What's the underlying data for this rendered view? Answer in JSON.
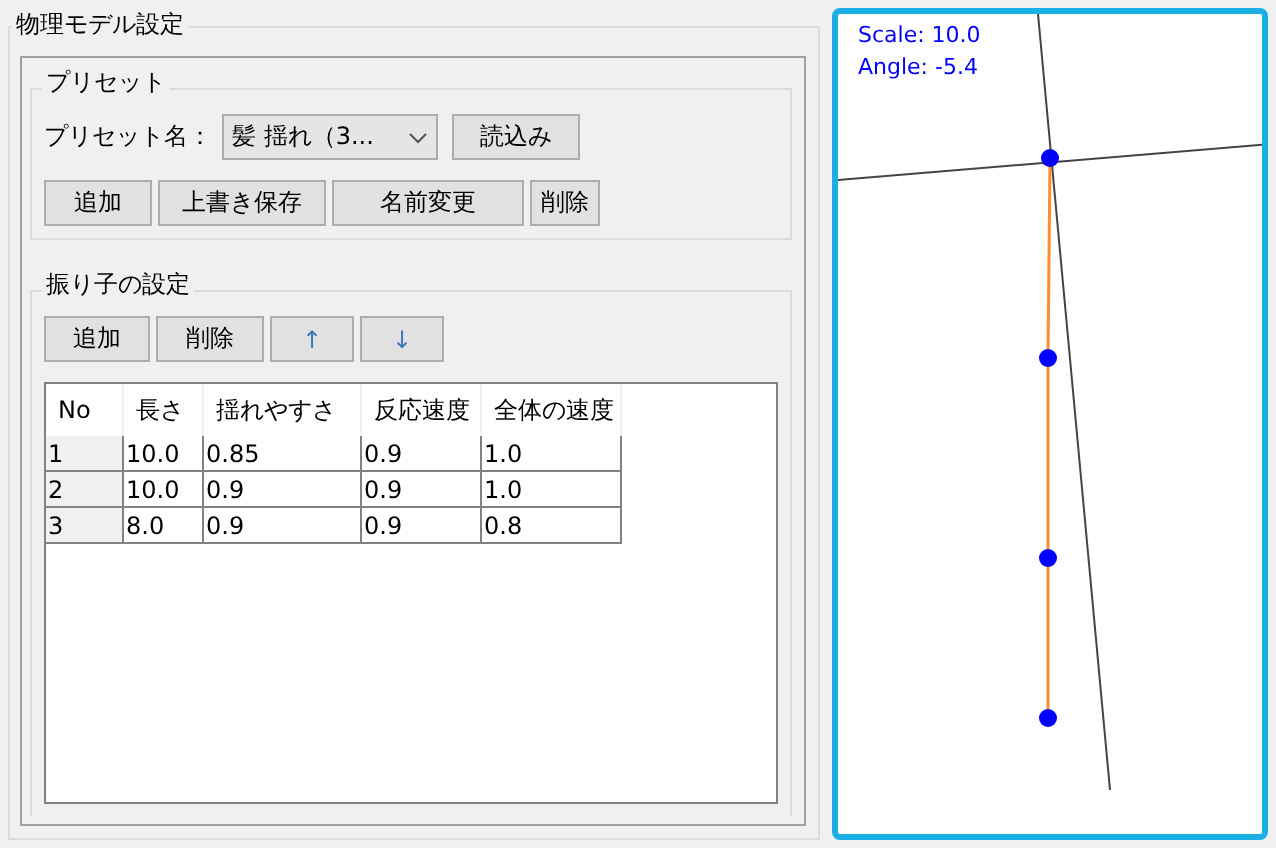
{
  "section_title": "物理モデル設定",
  "preset": {
    "title": "プリセット",
    "name_label": "プリセット名：",
    "selected_value": "髪  揺れ（3...",
    "load_button": "読込み",
    "buttons": [
      "追加",
      "上書き保存",
      "名前変更",
      "削除"
    ]
  },
  "pendulum": {
    "title": "振り子の設定",
    "buttons": [
      "追加",
      "削除",
      "↑",
      "↓"
    ],
    "table": {
      "columns": [
        "No",
        "長さ",
        "揺れやすさ",
        "反応速度",
        "全体の速度"
      ],
      "rows": [
        [
          "1",
          "10.0",
          "0.85",
          "0.9",
          "1.0"
        ],
        [
          "2",
          "10.0",
          "0.9",
          "0.9",
          "1.0"
        ],
        [
          "3",
          "8.0",
          "0.9",
          "0.9",
          "0.8"
        ]
      ]
    }
  },
  "preview": {
    "scale": "Scale: 10.0",
    "angle": "Angle: -5.4"
  }
}
